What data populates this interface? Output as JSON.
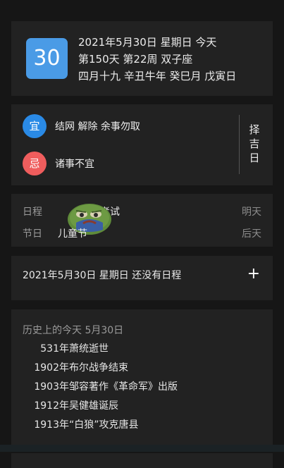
{
  "date_card": {
    "day": "30",
    "line1": "2021年5月30日 星期日 今天",
    "line2": "第150天 第22周 双子座",
    "line3": "四月十九 辛丑牛年 癸巳月 戊寅日"
  },
  "yiji": {
    "yi_badge": "宜",
    "yi_text": "结网 解除 余事勿取",
    "ji_badge": "忌",
    "ji_text": "诸事不宜",
    "zeji_label": "择吉日"
  },
  "schedule": {
    "row1_label": "日程",
    "row1_value": "考试",
    "row1_when": "明天",
    "row2_label": "节日",
    "row2_value": "儿童节",
    "row2_when": "后天"
  },
  "no_schedule": {
    "text": "2021年5月30日 星期日 还没有日程",
    "add_label": "+"
  },
  "history": {
    "title": "历史上的今天 5月30日",
    "items": [
      {
        "year": "531年",
        "event": "萧统逝世"
      },
      {
        "year": "1902年",
        "event": "布尔战争结束"
      },
      {
        "year": "1903年",
        "event": "邹容著作《革命军》出版"
      },
      {
        "year": "1912年",
        "event": "吴健雄诞辰"
      },
      {
        "year": "1913年",
        "event": "“白狼”攻克唐县"
      }
    ]
  },
  "colors": {
    "background": "#161616",
    "card": "#222222",
    "day_tile": "#4a9be6",
    "yi": "#2a8ae6",
    "ji": "#ef5d5d"
  }
}
